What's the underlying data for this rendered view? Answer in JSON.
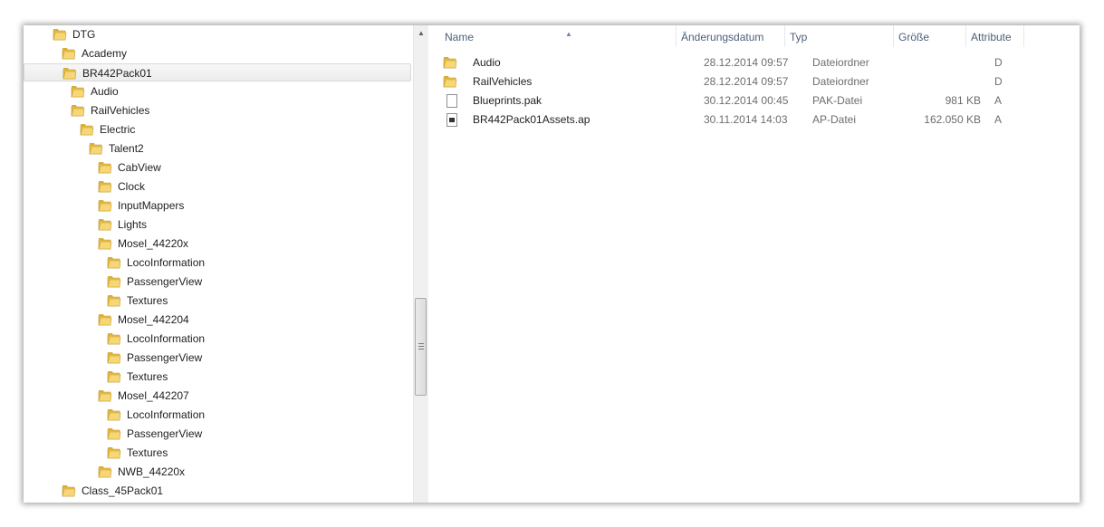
{
  "nav": {
    "items": [
      {
        "label": "DTG",
        "level": 0,
        "selected": false
      },
      {
        "label": "Academy",
        "level": 1,
        "selected": false
      },
      {
        "label": "BR442Pack01",
        "level": 1,
        "selected": true
      },
      {
        "label": "Audio",
        "level": 2,
        "selected": false
      },
      {
        "label": "RailVehicles",
        "level": 2,
        "selected": false
      },
      {
        "label": "Electric",
        "level": 3,
        "selected": false
      },
      {
        "label": "Talent2",
        "level": 4,
        "selected": false
      },
      {
        "label": "CabView",
        "level": 5,
        "selected": false
      },
      {
        "label": "Clock",
        "level": 5,
        "selected": false
      },
      {
        "label": "InputMappers",
        "level": 5,
        "selected": false
      },
      {
        "label": "Lights",
        "level": 5,
        "selected": false
      },
      {
        "label": "Mosel_44220x",
        "level": 5,
        "selected": false
      },
      {
        "label": "LocoInformation",
        "level": 6,
        "selected": false
      },
      {
        "label": "PassengerView",
        "level": 6,
        "selected": false
      },
      {
        "label": "Textures",
        "level": 6,
        "selected": false
      },
      {
        "label": "Mosel_442204",
        "level": 5,
        "selected": false
      },
      {
        "label": "LocoInformation",
        "level": 6,
        "selected": false
      },
      {
        "label": "PassengerView",
        "level": 6,
        "selected": false
      },
      {
        "label": "Textures",
        "level": 6,
        "selected": false
      },
      {
        "label": "Mosel_442207",
        "level": 5,
        "selected": false
      },
      {
        "label": "LocoInformation",
        "level": 6,
        "selected": false
      },
      {
        "label": "PassengerView",
        "level": 6,
        "selected": false
      },
      {
        "label": "Textures",
        "level": 6,
        "selected": false
      },
      {
        "label": "NWB_44220x",
        "level": 5,
        "selected": false
      },
      {
        "label": "Class_45Pack01",
        "level": 1,
        "selected": false
      }
    ]
  },
  "columns": {
    "name": "Name",
    "date": "Änderungsdatum",
    "type": "Typ",
    "size": "Größe",
    "attr": "Attribute"
  },
  "files": [
    {
      "name": "Audio",
      "date": "28.12.2014 09:57",
      "type": "Dateiordner",
      "size": "",
      "attr": "D",
      "icon": "folder-icon"
    },
    {
      "name": "RailVehicles",
      "date": "28.12.2014 09:57",
      "type": "Dateiordner",
      "size": "",
      "attr": "D",
      "icon": "folder-icon"
    },
    {
      "name": "Blueprints.pak",
      "date": "30.12.2014 00:45",
      "type": "PAK-Datei",
      "size": "981 KB",
      "attr": "A",
      "icon": "file-icon"
    },
    {
      "name": "BR442Pack01Assets.ap",
      "date": "30.11.2014 14:03",
      "type": "AP-Datei",
      "size": "162.050 KB",
      "attr": "A",
      "icon": "archive-file-icon"
    }
  ],
  "colors": {
    "folder": "#e9c14a",
    "header_text": "#4c607a"
  }
}
